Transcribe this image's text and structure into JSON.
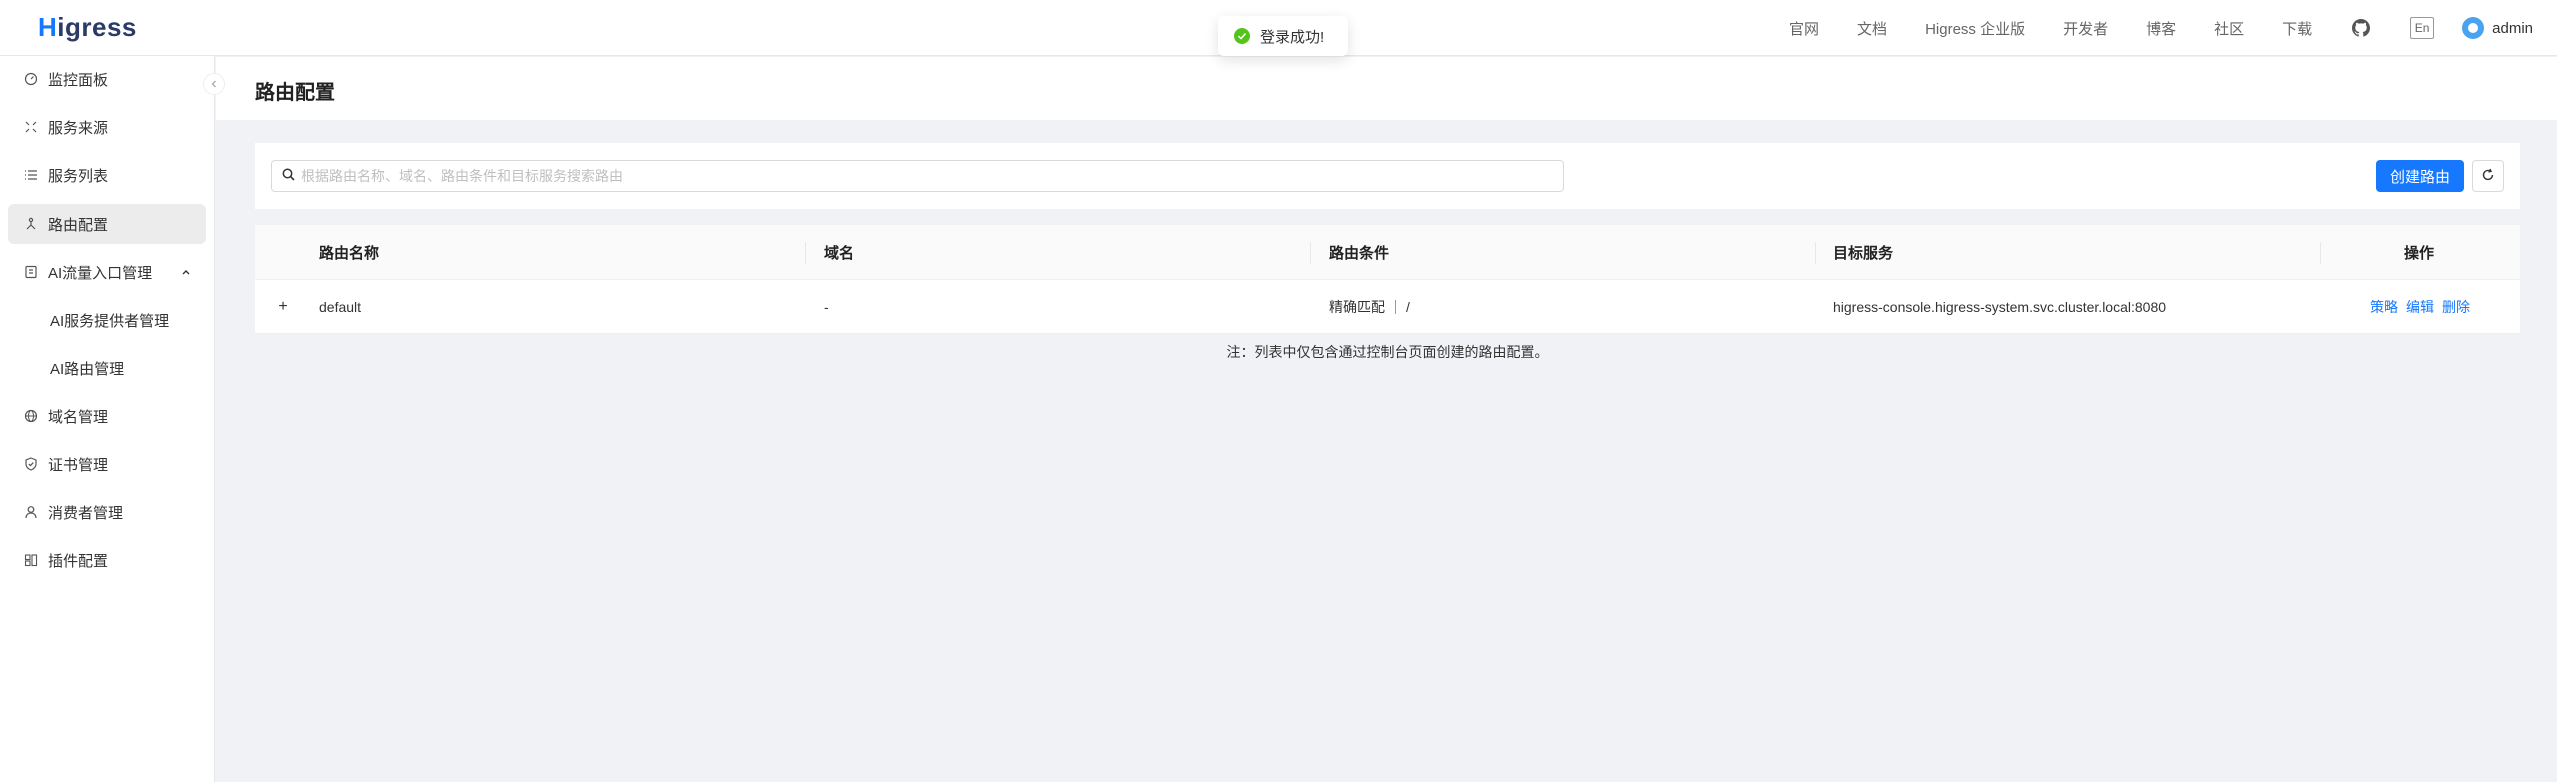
{
  "header": {
    "logo_text": "Higress",
    "nav": [
      "官网",
      "文档",
      "Higress 企业版",
      "开发者",
      "博客",
      "社区",
      "下载"
    ],
    "lang": "En",
    "user": "admin"
  },
  "toast": {
    "text": "登录成功!"
  },
  "sidebar": {
    "items": [
      {
        "label": "监控面板",
        "icon": "dashboard-icon"
      },
      {
        "label": "服务来源",
        "icon": "source-icon"
      },
      {
        "label": "服务列表",
        "icon": "list-icon"
      },
      {
        "label": "路由配置",
        "icon": "route-icon"
      },
      {
        "label": "AI流量入口管理",
        "icon": "ai-icon"
      },
      {
        "label": "AI服务提供者管理"
      },
      {
        "label": "AI路由管理"
      },
      {
        "label": "域名管理",
        "icon": "globe-icon"
      },
      {
        "label": "证书管理",
        "icon": "shield-icon"
      },
      {
        "label": "消费者管理",
        "icon": "user-icon"
      },
      {
        "label": "插件配置",
        "icon": "plugin-icon"
      }
    ]
  },
  "page": {
    "title": "路由配置"
  },
  "search": {
    "placeholder": "根据路由名称、域名、路由条件和目标服务搜索路由"
  },
  "toolbar": {
    "create_label": "创建路由"
  },
  "table": {
    "columns": [
      "路由名称",
      "域名",
      "路由条件",
      "目标服务",
      "操作"
    ],
    "rows": [
      {
        "name": "default",
        "domain": "-",
        "match_type": "精确匹配",
        "match_path": "/",
        "target": "higress-console.higress-system.svc.cluster.local:8080",
        "actions": [
          "策略",
          "编辑",
          "删除"
        ]
      }
    ]
  },
  "note": "注：列表中仅包含通过控制台页面创建的路由配置。",
  "colors": {
    "primary": "#1677ff",
    "success": "#52c41a"
  }
}
